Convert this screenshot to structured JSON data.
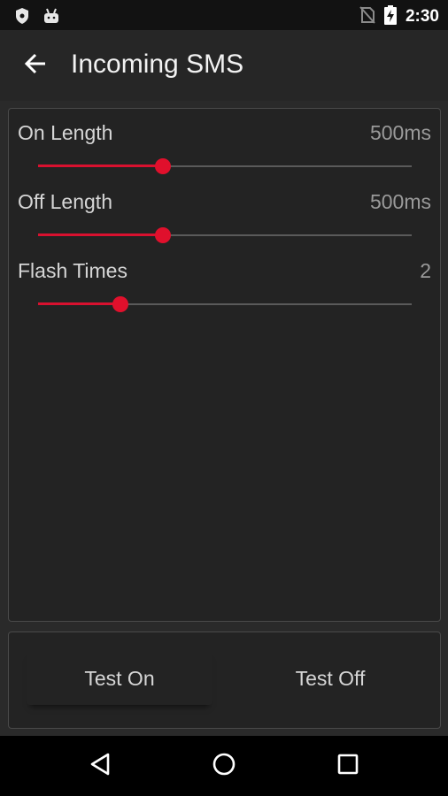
{
  "status_bar": {
    "time": "2:30",
    "icons": [
      "shield-icon",
      "android-icon",
      "no-sim-icon",
      "battery-charging-icon"
    ]
  },
  "app_bar": {
    "back_icon": "arrow-left-icon",
    "title": "Incoming SMS"
  },
  "settings": [
    {
      "label": "On Length",
      "value": "500ms",
      "level": 0.335
    },
    {
      "label": "Off Length",
      "value": "500ms",
      "level": 0.335
    },
    {
      "label": "Flash Times",
      "value": "2",
      "level": 0.22
    }
  ],
  "buttons": {
    "test_on": "Test On",
    "test_off": "Test Off"
  },
  "nav_bar": {
    "icons": [
      "back-triangle-icon",
      "home-circle-icon",
      "recents-square-icon"
    ]
  },
  "colors": {
    "accent": "#e0102c",
    "background": "#232323",
    "status_bar": "#121212",
    "nav_bar": "#000000"
  }
}
